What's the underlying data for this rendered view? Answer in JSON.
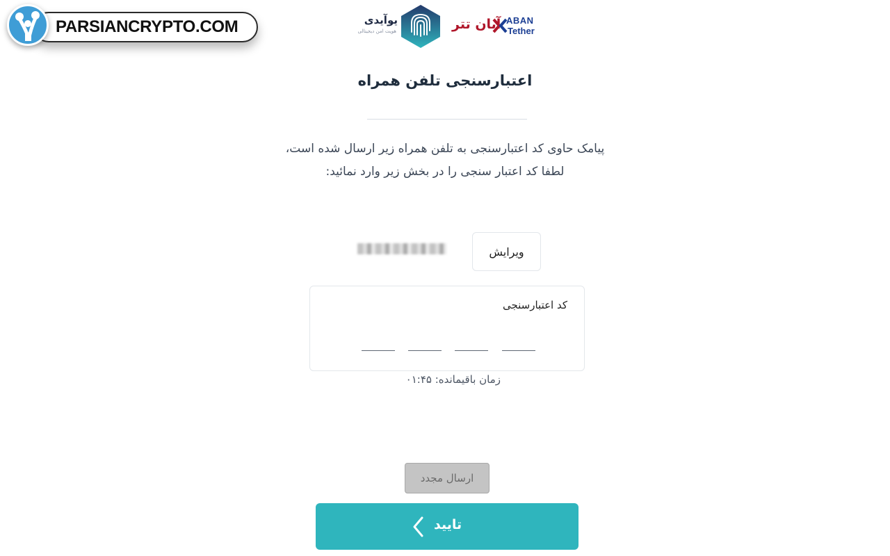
{
  "watermark": {
    "text": "PARSIANCRYPTO.COM"
  },
  "header": {
    "uid_logo": {
      "name": "یوآیدی",
      "tagline": "هویت امن دیجیتالی"
    },
    "aban_logo": {
      "name_fa": "آبان تتر",
      "name_en_1": "ABAN",
      "name_en_2": "Tether"
    }
  },
  "page": {
    "title": "اعتبارسنجی تلفن همراه",
    "description": "پیامک حاوی کد اعتبارسنجی به تلفن همراه زیر ارسال شده است، لطفا کد اعتبار سنجی را در بخش زیر وارد نمائید:"
  },
  "phone": {
    "edit_label": "ویرایش"
  },
  "code_field": {
    "label": "کد اعتبارسنجی",
    "digit_count": 4
  },
  "timer": {
    "text": "زمان باقیمانده: ۰۱:۴۵"
  },
  "actions": {
    "resend_label": "ارسال مجدد",
    "confirm_label": "تایید"
  },
  "colors": {
    "primary": "#2fb5bd",
    "disabled": "#c4c4c4",
    "brand_red": "#b0162a",
    "brand_blue": "#1c3f94"
  }
}
